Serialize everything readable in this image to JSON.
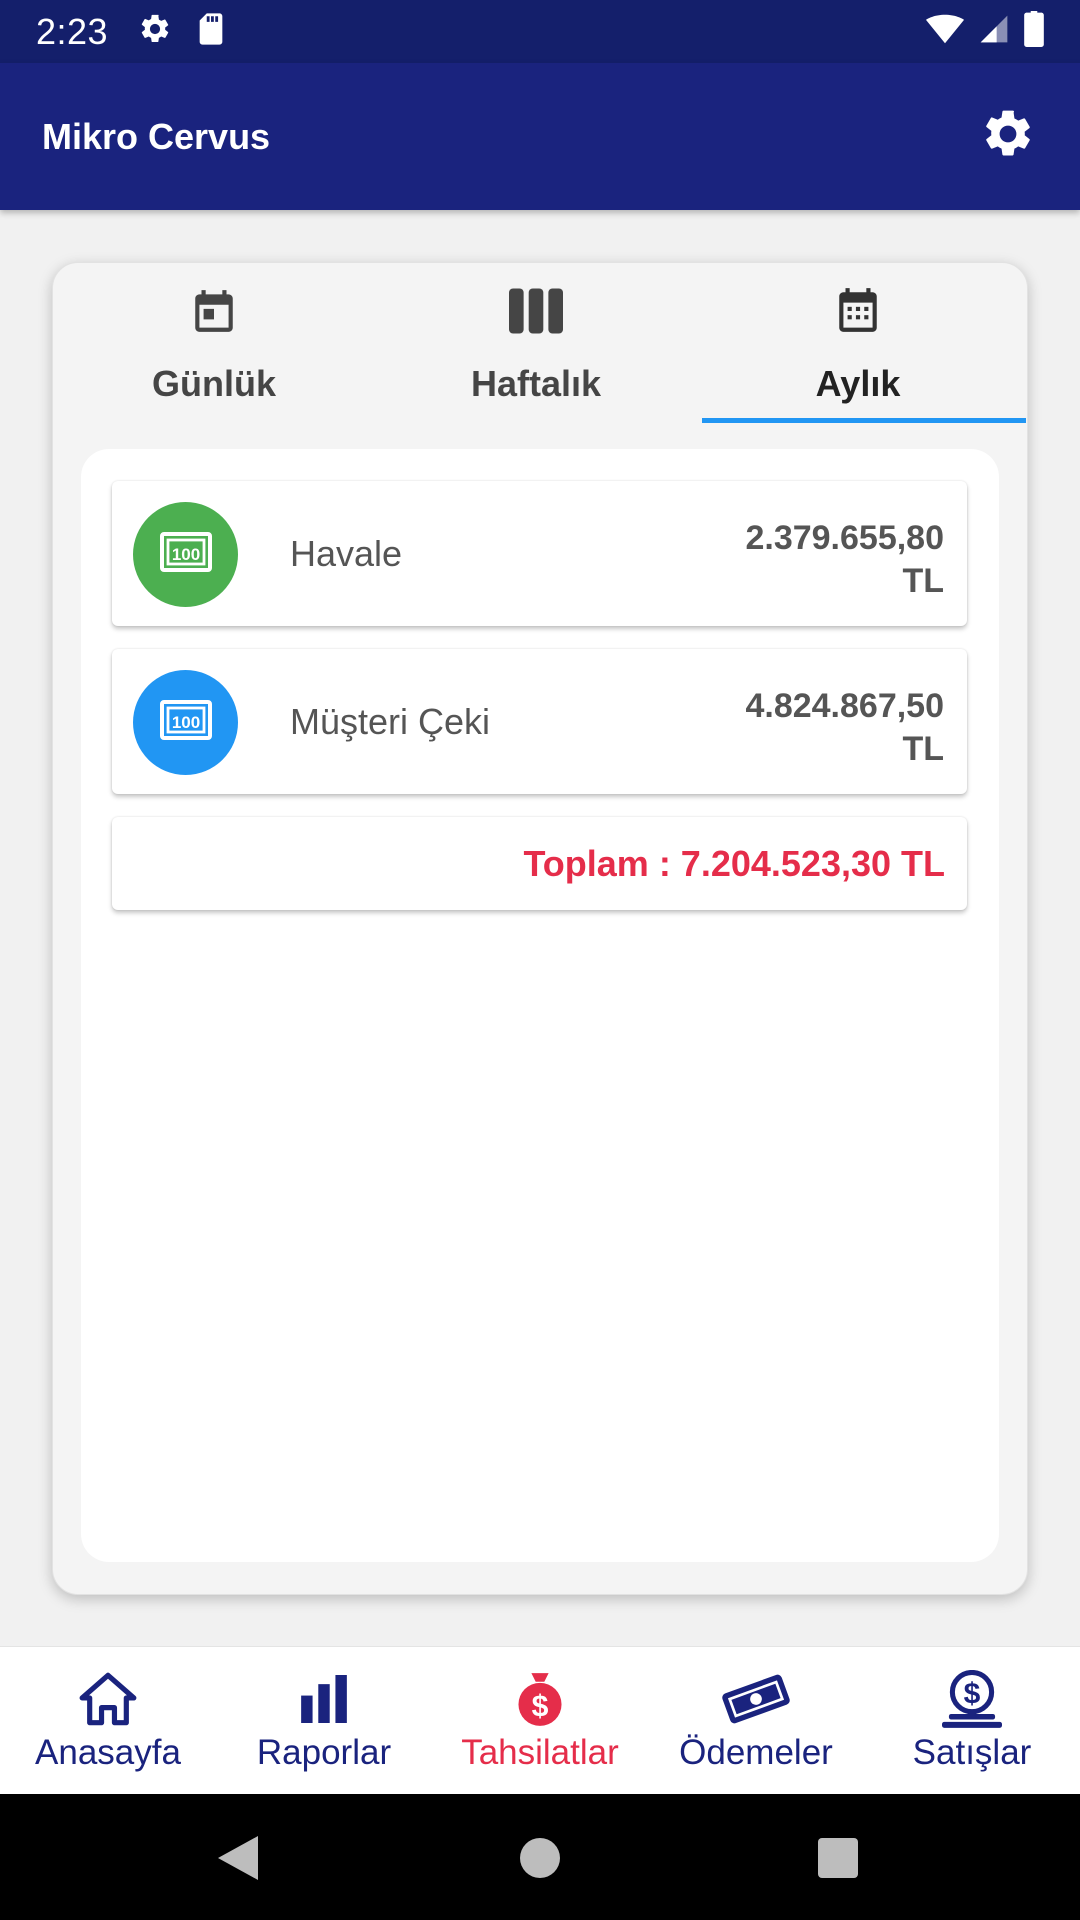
{
  "status_bar": {
    "time": "2:23",
    "icons": [
      "gear-icon",
      "sd-card-icon",
      "wifi-icon",
      "signal-icon",
      "battery-icon"
    ]
  },
  "app_bar": {
    "title": "Mikro Cervus",
    "settings_icon": "gear-icon"
  },
  "tabs": [
    {
      "label": "Günlük",
      "icon": "calendar-day-icon",
      "active": false
    },
    {
      "label": "Haftalık",
      "icon": "week-columns-icon",
      "active": false
    },
    {
      "label": "Aylık",
      "icon": "calendar-month-icon",
      "active": true
    }
  ],
  "items": [
    {
      "name": "Havale",
      "amount_line1": "2.379.655,80",
      "amount_line2": "TL",
      "icon": "money-icon",
      "color": "#4caf50"
    },
    {
      "name": "Müşteri Çeki",
      "amount_line1": "4.824.867,50",
      "amount_line2": "TL",
      "icon": "money-icon",
      "color": "#2196f3"
    }
  ],
  "total": {
    "text": "Toplam : 7.204.523,30 TL",
    "color": "#e52d4a"
  },
  "bottom_nav": [
    {
      "label": "Anasayfa",
      "icon": "home-icon",
      "active": false
    },
    {
      "label": "Raporlar",
      "icon": "bar-chart-icon",
      "active": false
    },
    {
      "label": "Tahsilatlar",
      "icon": "money-bag-icon",
      "active": true
    },
    {
      "label": "Ödemeler",
      "icon": "banknote-icon",
      "active": false
    },
    {
      "label": "Satışlar",
      "icon": "dollar-hand-icon",
      "active": false
    }
  ],
  "colors": {
    "primary": "#1a237e",
    "status_bar": "#141f6b",
    "accent_red": "#e52d4a",
    "tab_indicator": "#2196f3"
  },
  "system_nav": [
    "back-icon",
    "home-circle-icon",
    "recents-icon"
  ]
}
